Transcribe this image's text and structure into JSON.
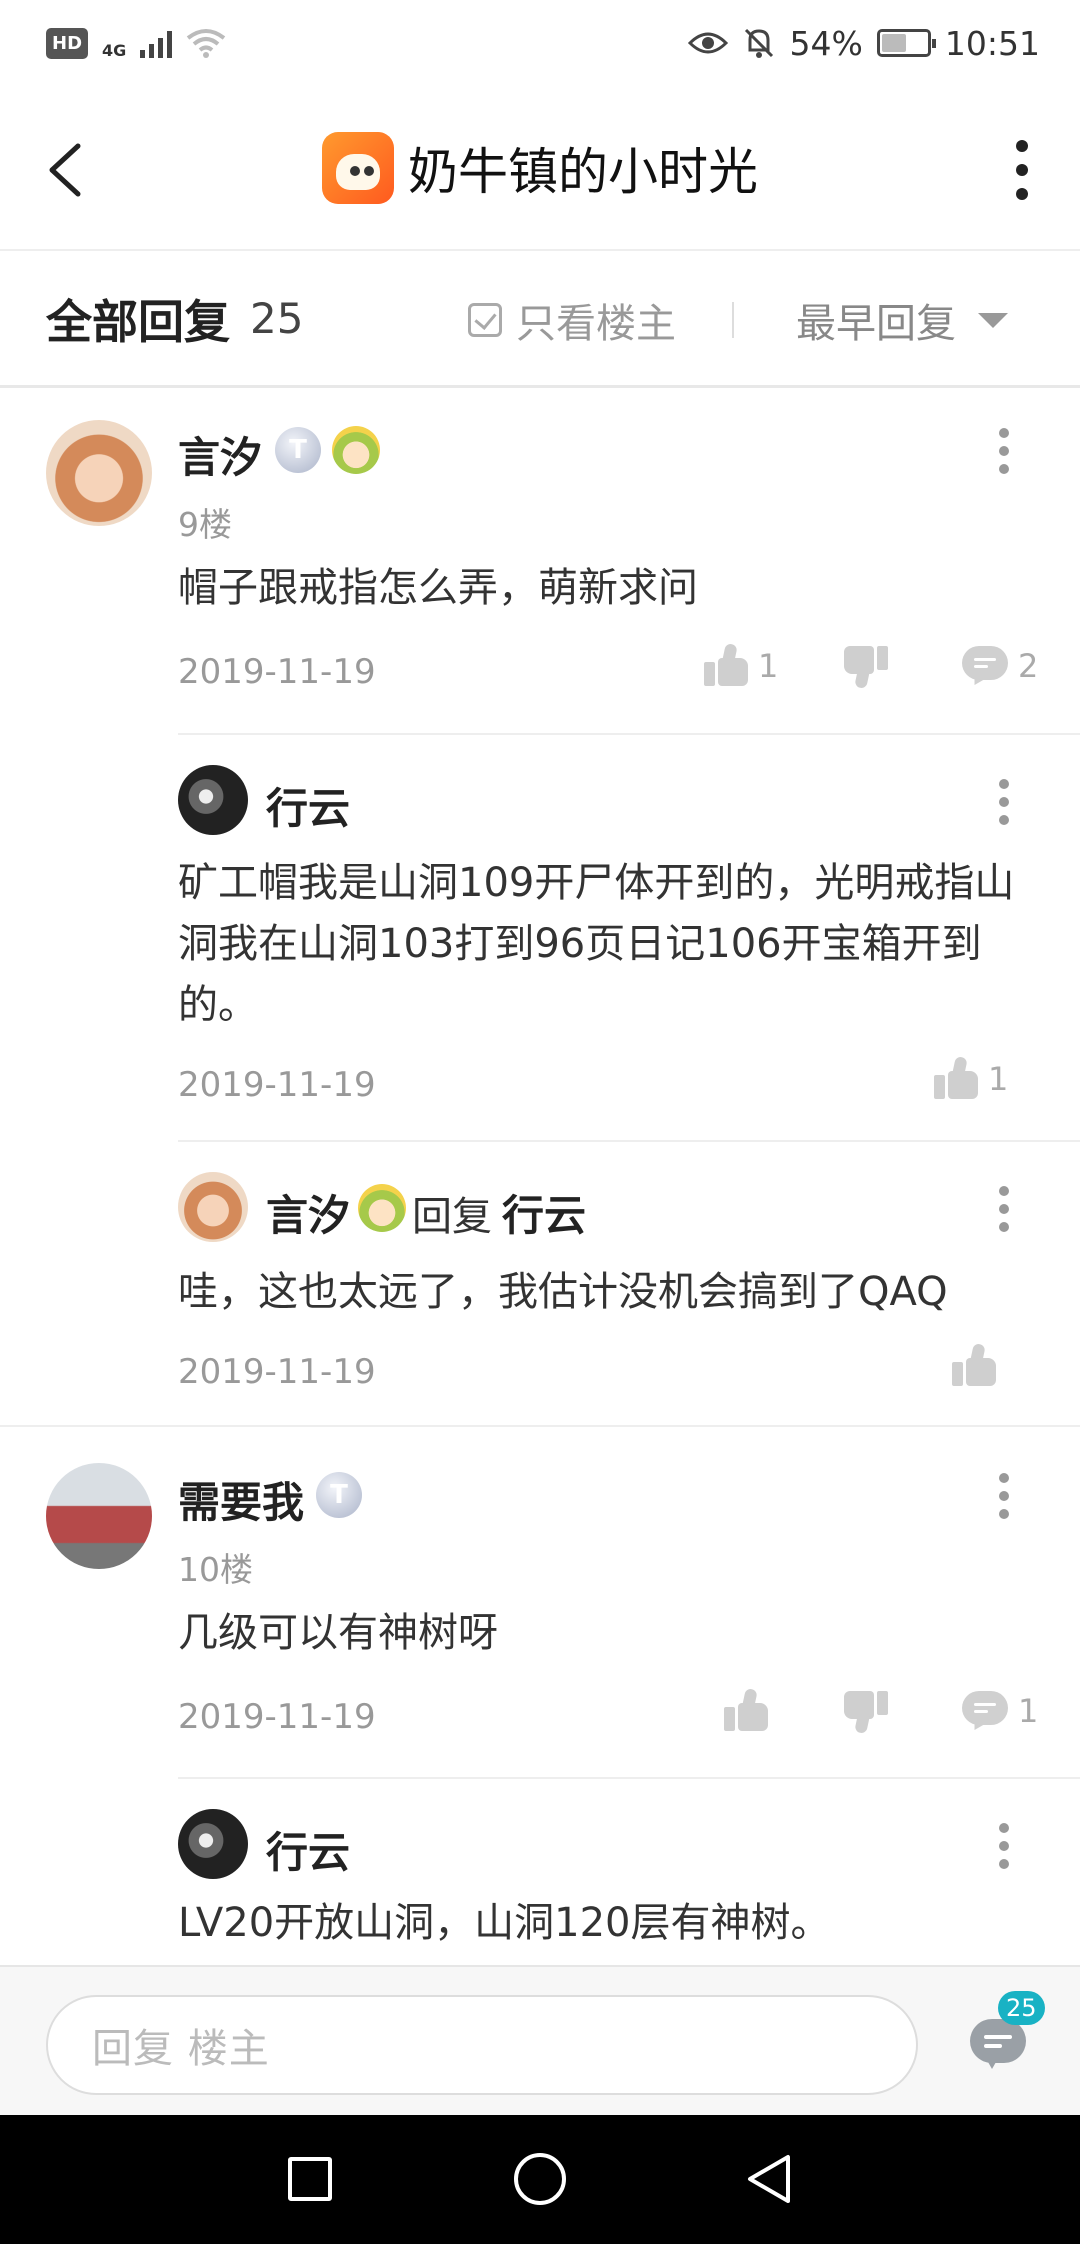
{
  "status_bar": {
    "hd": "HD",
    "network": "4G",
    "battery": "54%",
    "battery_level": 0.54,
    "time": "10:51"
  },
  "header": {
    "title": "奶牛镇的小时光",
    "icons": {
      "back": "back-arrow-icon",
      "more": "more-vertical-icon",
      "app": "app-icon"
    }
  },
  "filter_bar": {
    "all_replies": "全部回复",
    "count": "25",
    "only_op": "只看楼主",
    "sort": "最早回复"
  },
  "comments": [
    {
      "username": "言汐",
      "level_badge": "T2",
      "floor": "9楼",
      "content": "帽子跟戒指怎么弄，萌新求问",
      "date": "2019-11-19",
      "likes": "1",
      "replies": "2",
      "sub_replies": [
        {
          "username": "行云",
          "content": "矿工帽我是山洞109开尸体开到的，光明戒指山洞我在山洞103打到96页日记106开宝箱开到的。",
          "date": "2019-11-19",
          "likes": "1"
        },
        {
          "username": "言汐",
          "reply_word": "回复",
          "reply_to": "行云",
          "content": "哇，这也太远了，我估计没机会搞到了QAQ",
          "date": "2019-11-19"
        }
      ]
    },
    {
      "username": "需要我",
      "level_badge": "T2",
      "floor": "10楼",
      "content": "几级可以有神树呀",
      "date": "2019-11-19",
      "replies": "1",
      "sub_replies": [
        {
          "username": "行云",
          "content": "LV20开放山洞，山洞120层有神树。"
        }
      ]
    }
  ],
  "reply_bar": {
    "placeholder": "回复  楼主",
    "comment_count_badge": "25",
    "badge_color": "#19b2c4"
  }
}
